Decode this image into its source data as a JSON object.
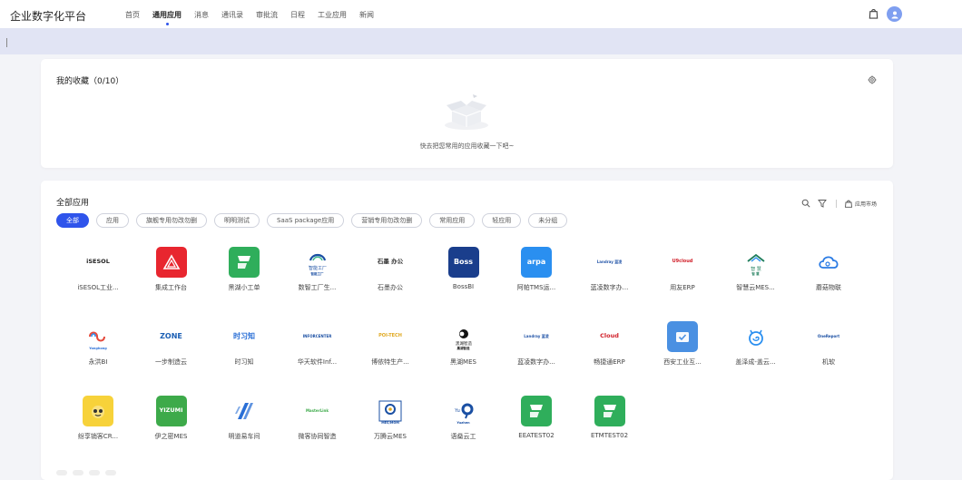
{
  "header": {
    "brand": "企业数字化平台",
    "nav": [
      {
        "label": "首页",
        "active": false
      },
      {
        "label": "通用应用",
        "active": true
      },
      {
        "label": "消息",
        "active": false
      },
      {
        "label": "通讯录",
        "active": false
      },
      {
        "label": "审批流",
        "active": false
      },
      {
        "label": "日程",
        "active": false
      },
      {
        "label": "工业应用",
        "active": false
      },
      {
        "label": "新闻",
        "active": false
      }
    ],
    "accent": "#2f54eb"
  },
  "favorites": {
    "title": "我的收藏（0/10）",
    "empty_text": "快去把您常用的应用收藏一下吧~"
  },
  "apps": {
    "title": "全部应用",
    "market_label": "应用市场",
    "filters": [
      {
        "label": "全部",
        "active": true
      },
      {
        "label": "应用",
        "active": false
      },
      {
        "label": "旗舰专用勿改勿删",
        "active": false
      },
      {
        "label": "明明测试",
        "active": false
      },
      {
        "label": "SaaS package应用",
        "active": false
      },
      {
        "label": "营销专用勿改勿删",
        "active": false
      },
      {
        "label": "常用应用",
        "active": false
      },
      {
        "label": "轻应用",
        "active": false
      },
      {
        "label": "未分组",
        "active": false
      }
    ],
    "items": [
      {
        "name": "iSESOL工业...",
        "icon": "isesol-logo",
        "bg": "#ffffff",
        "fg": "#222222",
        "text": "iSESOL"
      },
      {
        "name": "集成工作台",
        "icon": "triangle-logo",
        "bg": "#e8262f",
        "fg": "#ffffff",
        "text": ""
      },
      {
        "name": "黑湖小工单",
        "icon": "blackhole-flag-logo",
        "bg": "#2fae5b",
        "fg": "#ffffff",
        "text": ""
      },
      {
        "name": "数智工厂生...",
        "icon": "smart-factory-logo",
        "bg": "#ffffff",
        "fg": "#1a4fa3",
        "text": "智能工厂"
      },
      {
        "name": "石墨办公",
        "icon": "shimo-logo",
        "bg": "#ffffff",
        "fg": "#333333",
        "text": "石墨 办公"
      },
      {
        "name": "BossBI",
        "icon": "bossbi-logo",
        "bg": "#1a3e8c",
        "fg": "#ffffff",
        "text": "Boss"
      },
      {
        "name": "阿帕TMS运...",
        "icon": "arpa-logo",
        "bg": "#2a8ff0",
        "fg": "#ffffff",
        "text": "arpa"
      },
      {
        "name": "蓝凌数字办...",
        "icon": "landray-logo",
        "bg": "#ffffff",
        "fg": "#2355a8",
        "text": "Landray 蓝凌"
      },
      {
        "name": "用友ERP",
        "icon": "u9cloud-logo",
        "bg": "#ffffff",
        "fg": "#d1202a",
        "text": "U9cloud"
      },
      {
        "name": "智慧云MES...",
        "icon": "zhihui-logo",
        "bg": "#ffffff",
        "fg": "#1e7d5b",
        "text": "智 慧"
      },
      {
        "name": "蘑菇物联",
        "icon": "cloud-outline-logo",
        "bg": "#ffffff",
        "fg": "#2a7be4",
        "text": ""
      },
      {
        "name": "永洪BI",
        "icon": "yonghong-logo",
        "bg": "#ffffff",
        "fg": "#2a6fd6",
        "text": "Yonghong"
      },
      {
        "name": "一步制造云",
        "icon": "zone-logo",
        "bg": "#ffffff",
        "fg": "#1b5fb4",
        "text": "ZONE"
      },
      {
        "name": "时习知",
        "icon": "shixizhi-logo",
        "bg": "#ffffff",
        "fg": "#2a6fd6",
        "text": "时习知"
      },
      {
        "name": "华天软件Inf...",
        "icon": "inforcenter-logo",
        "bg": "#ffffff",
        "fg": "#1a4fa3",
        "text": "INFORCENTER"
      },
      {
        "name": "博依特生产...",
        "icon": "poi-tech-logo",
        "bg": "#ffffff",
        "fg": "#e0a820",
        "text": "POI-TECH"
      },
      {
        "name": "黑湖MES",
        "icon": "blacklake-logo",
        "bg": "#ffffff",
        "fg": "#111111",
        "text": "黑湖智造"
      },
      {
        "name": "蓝凌数字办...",
        "icon": "landray-logo",
        "bg": "#ffffff",
        "fg": "#2355a8",
        "text": "Landray 蓝凌"
      },
      {
        "name": "畅捷通ERP",
        "icon": "tcloud-logo",
        "bg": "#ffffff",
        "fg": "#d1202a",
        "text": "Cloud"
      },
      {
        "name": "西安工业互...",
        "icon": "checkmark-app-logo",
        "bg": "#4a90e2",
        "fg": "#ffffff",
        "text": ""
      },
      {
        "name": "盖泽成-盖云...",
        "icon": "spiral-cat-logo",
        "bg": "#ffffff",
        "fg": "#2a8ff0",
        "text": ""
      },
      {
        "name": "机软",
        "icon": "jiruan-logo",
        "bg": "#ffffff",
        "fg": "#1a4fa3",
        "text": "OneReport"
      },
      {
        "name": "纷享销客CR...",
        "icon": "fxiaoke-logo",
        "bg": "#f7d23a",
        "fg": "#333333",
        "text": ""
      },
      {
        "name": "伊之密MES",
        "icon": "yizumi-logo",
        "bg": "#3daa4a",
        "fg": "#ffffff",
        "text": "YIZUMI"
      },
      {
        "name": "明道易车间",
        "icon": "mingdao-stripes-logo",
        "bg": "#ffffff",
        "fg": "#2a6fd6",
        "text": ""
      },
      {
        "name": "微客协同智造",
        "icon": "masterlink-logo",
        "bg": "#ffffff",
        "fg": "#3daa4a",
        "text": "MasterLink"
      },
      {
        "name": "万腾云MES",
        "icon": "wanteng-logo",
        "bg": "#ffffff",
        "fg": "#1a4fa3",
        "text": "MES/MOM"
      },
      {
        "name": "语燊云工",
        "icon": "yuzhen-logo",
        "bg": "#ffffff",
        "fg": "#1a4fa3",
        "text": "Yuzhen"
      },
      {
        "name": "EEATEST02",
        "icon": "blackhole-flag-logo",
        "bg": "#2fae5b",
        "fg": "#ffffff",
        "text": ""
      },
      {
        "name": "ETMTEST02",
        "icon": "blackhole-flag-logo",
        "bg": "#2fae5b",
        "fg": "#ffffff",
        "text": ""
      }
    ]
  }
}
